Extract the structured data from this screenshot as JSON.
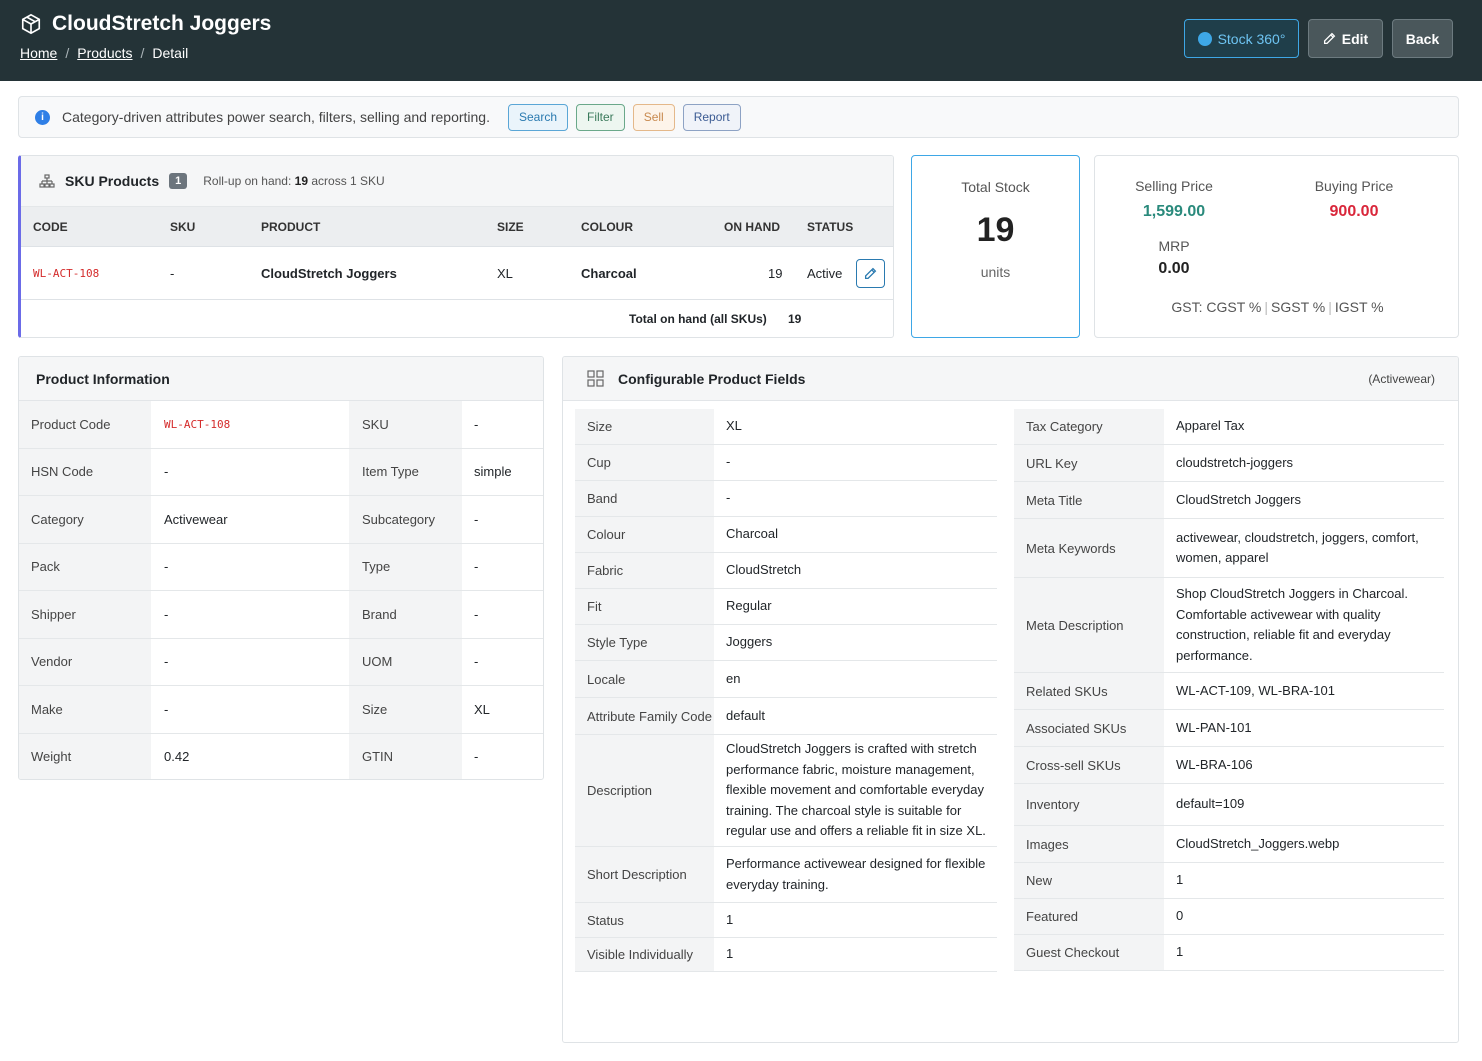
{
  "header": {
    "title": "CloudStretch Joggers",
    "breadcrumb": [
      "Home",
      "Products",
      "Detail"
    ],
    "buttons": {
      "stock": "Stock 360°",
      "edit": "Edit",
      "back": "Back"
    }
  },
  "info": {
    "text": "Category-driven attributes power search, filters, selling and reporting.",
    "pills": [
      "Search",
      "Filter",
      "Sell",
      "Report"
    ]
  },
  "sku": {
    "title": "SKU Products",
    "count": "1",
    "rollup_prefix": "Roll-up on hand:",
    "rollup_value": "19",
    "rollup_suffix": "across 1 SKU",
    "columns": [
      "CODE",
      "SKU",
      "PRODUCT",
      "SIZE",
      "COLOUR",
      "ON HAND",
      "STATUS"
    ],
    "row": {
      "code": "WL-ACT-108",
      "sku": "-",
      "product": "CloudStretch Joggers",
      "size": "XL",
      "colour": "Charcoal",
      "on_hand": "19",
      "status": "Active"
    },
    "total_label": "Total on hand (all SKUs)",
    "total_value": "19"
  },
  "stock": {
    "label": "Total Stock",
    "value": "19",
    "unit": "units"
  },
  "price": {
    "selling_label": "Selling Price",
    "selling": "1,599.00",
    "buying_label": "Buying Price",
    "buying": "900.00",
    "mrp_label": "MRP",
    "mrp": "0.00",
    "gst": [
      "GST: CGST %",
      "SGST %",
      "IGST %"
    ]
  },
  "product_info": {
    "title": "Product Information",
    "rows": [
      {
        "k1": "Product Code",
        "v1": "WL-ACT-108",
        "k2": "SKU",
        "v2": "-"
      },
      {
        "k1": "HSN Code",
        "v1": "-",
        "k2": "Item Type",
        "v2": "simple"
      },
      {
        "k1": "Category",
        "v1": "Activewear",
        "k2": "Subcategory",
        "v2": "-"
      },
      {
        "k1": "Pack",
        "v1": "-",
        "k2": "Type",
        "v2": "-"
      },
      {
        "k1": "Shipper",
        "v1": "-",
        "k2": "Brand",
        "v2": "-"
      },
      {
        "k1": "Vendor",
        "v1": "-",
        "k2": "UOM",
        "v2": "-"
      },
      {
        "k1": "Make",
        "v1": "-",
        "k2": "Size",
        "v2": "XL"
      },
      {
        "k1": "Weight",
        "v1": "0.42",
        "k2": "GTIN",
        "v2": "-"
      }
    ]
  },
  "config": {
    "title": "Configurable Product Fields",
    "family": "(Activewear)",
    "left": [
      {
        "k": "Size",
        "v": "XL"
      },
      {
        "k": "Cup",
        "v": "-"
      },
      {
        "k": "Band",
        "v": "-"
      },
      {
        "k": "Colour",
        "v": "Charcoal"
      },
      {
        "k": "Fabric",
        "v": "CloudStretch"
      },
      {
        "k": "Fit",
        "v": "Regular"
      },
      {
        "k": "Style Type",
        "v": "Joggers"
      },
      {
        "k": "Locale",
        "v": "en"
      },
      {
        "k": "Attribute Family Code",
        "v": "default"
      },
      {
        "k": "Description",
        "v": "CloudStretch Joggers is crafted with stretch performance fabric, moisture management, flexible movement and comfortable everyday training. The charcoal style is suitable for regular use and offers a reliable fit in size XL."
      },
      {
        "k": "Short Description",
        "v": "Performance activewear designed for flexible everyday training."
      },
      {
        "k": "Status",
        "v": "1"
      },
      {
        "k": "Visible Individually",
        "v": "1"
      }
    ],
    "right": [
      {
        "k": "Tax Category",
        "v": "Apparel Tax"
      },
      {
        "k": "URL Key",
        "v": "cloudstretch-joggers"
      },
      {
        "k": "Meta Title",
        "v": "CloudStretch Joggers"
      },
      {
        "k": "Meta Keywords",
        "v": "activewear, cloudstretch, joggers, comfort, women, apparel"
      },
      {
        "k": "Meta Description",
        "v": "Shop CloudStretch Joggers in Charcoal. Comfortable activewear with quality construction, reliable fit and everyday performance."
      },
      {
        "k": "Related SKUs",
        "v": "WL-ACT-109, WL-BRA-101"
      },
      {
        "k": "Associated SKUs",
        "v": "WL-PAN-101"
      },
      {
        "k": "Cross-sell SKUs",
        "v": "WL-BRA-106"
      },
      {
        "k": "Inventory",
        "v": "default=109"
      },
      {
        "k": "Images",
        "v": "CloudStretch_Joggers.webp"
      },
      {
        "k": "New",
        "v": "1"
      },
      {
        "k": "Featured",
        "v": "0"
      },
      {
        "k": "Guest Checkout",
        "v": "1"
      }
    ]
  },
  "colors": {
    "header": "#243337",
    "accent": "#3ea7e6",
    "selling": "#2a8a7c",
    "buying": "#d9263a",
    "code": "#d42b2b"
  }
}
